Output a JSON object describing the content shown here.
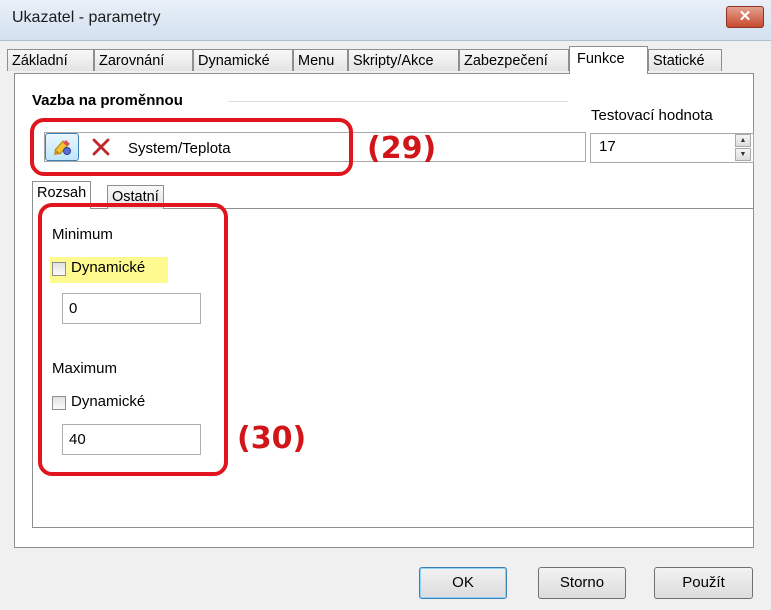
{
  "window": {
    "title": "Ukazatel - parametry",
    "close_glyph": "✕"
  },
  "tabs": [
    {
      "label": "Základní",
      "active": false
    },
    {
      "label": "Zarovnání",
      "active": false
    },
    {
      "label": "Dynamické",
      "active": false
    },
    {
      "label": "Menu",
      "active": false
    },
    {
      "label": "Skripty/Akce",
      "active": false
    },
    {
      "label": "Zabezpečení",
      "active": false
    },
    {
      "label": "Funkce",
      "active": true
    },
    {
      "label": "Statické",
      "active": false
    }
  ],
  "binding": {
    "group_label": "Vazba na proměnnou",
    "variable_value": "System/Teplota",
    "assign_icon": "assign-variable-icon",
    "clear_icon": "delete-x-icon"
  },
  "test_value": {
    "label": "Testovací hodnota",
    "value": "17"
  },
  "subtabs": [
    {
      "label": "Rozsah",
      "active": true
    },
    {
      "label": "Ostatní",
      "active": false
    }
  ],
  "range": {
    "minimum_label": "Minimum",
    "minimum_dynamic_label": "Dynamické",
    "minimum_dynamic_checked": false,
    "minimum_value": "0",
    "maximum_label": "Maximum",
    "maximum_dynamic_label": "Dynamické",
    "maximum_dynamic_checked": false,
    "maximum_value": "40"
  },
  "buttons": {
    "ok": "OK",
    "cancel": "Storno",
    "apply": "Použít"
  },
  "annotations": {
    "a29": "(29)",
    "a30": "(30)",
    "color": "#e0151d"
  }
}
